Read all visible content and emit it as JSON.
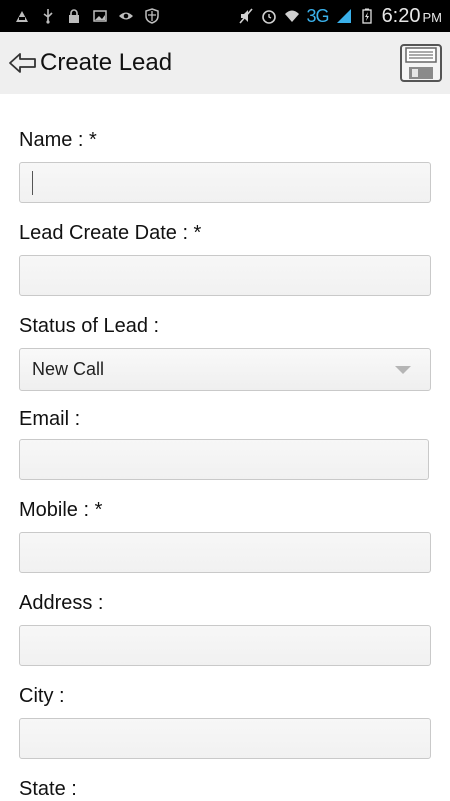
{
  "status_bar": {
    "time": "6:20",
    "ampm": "PM",
    "network": "3G"
  },
  "action_bar": {
    "title": "Create Lead"
  },
  "form": {
    "name_label": "Name : *",
    "name_value": "",
    "create_date_label": "Lead Create Date : *",
    "create_date_value": "",
    "status_label": "Status of Lead :",
    "status_value": "New Call",
    "email_label": "Email :",
    "email_value": "",
    "mobile_label": "Mobile : *",
    "mobile_value": "",
    "address_label": "Address :",
    "address_value": "",
    "city_label": "City :",
    "city_value": "",
    "state_label": "State :"
  },
  "icons": {
    "back": "back-arrow-icon",
    "save": "floppy-disk-icon"
  }
}
